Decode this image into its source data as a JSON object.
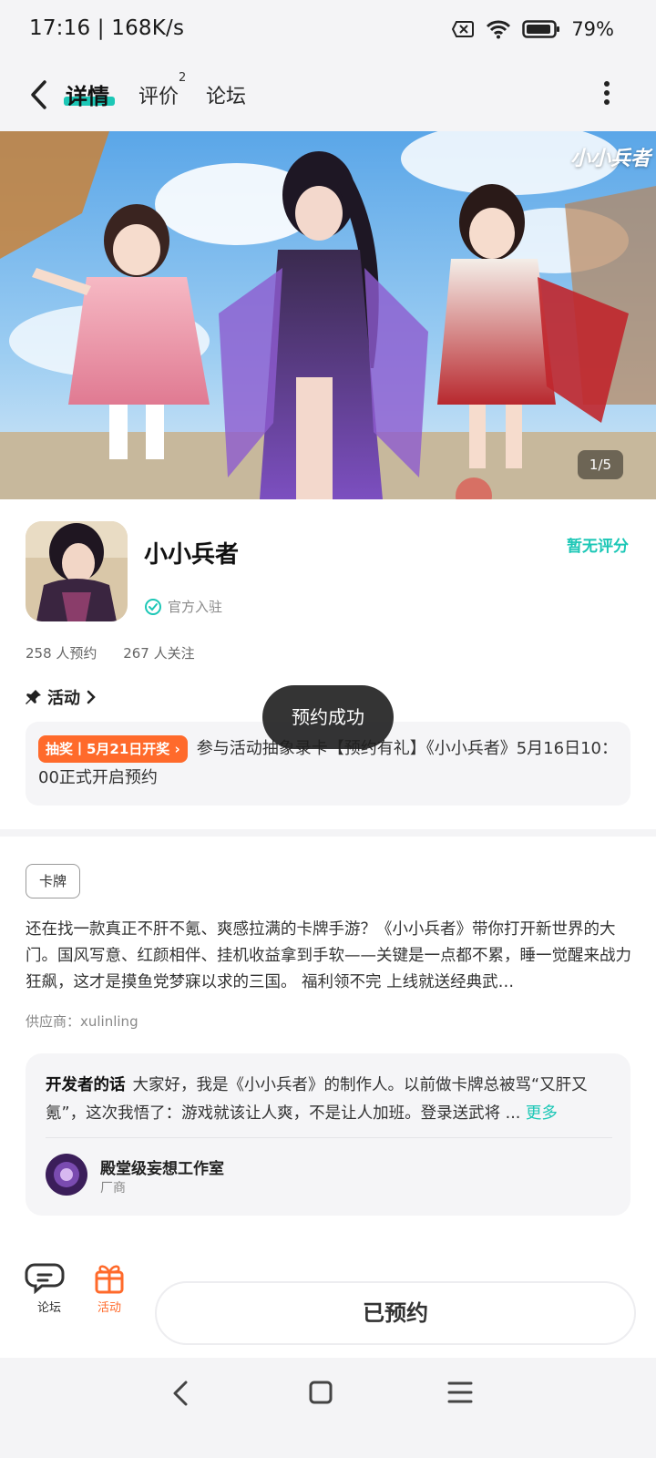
{
  "status_bar": {
    "time": "17:16 | 168K/s",
    "battery": "79%"
  },
  "header": {
    "tabs": [
      {
        "label": "详情",
        "active": true
      },
      {
        "label": "评价",
        "badge": "2"
      },
      {
        "label": "论坛"
      }
    ]
  },
  "banner": {
    "logo_text": "小小兵者",
    "page_indicator": "1/5"
  },
  "game": {
    "title": "小小兵者",
    "rating": "暂无评分",
    "official": "官方入驻",
    "reservations": "258 人预约",
    "followers": "267 人关注"
  },
  "activity": {
    "heading": "活动",
    "tag": "抽奖丨5月21日开奖",
    "text": "参与活动抽象录卡【预约有礼】《小小兵者》5月16日10：00正式开启预约"
  },
  "toast": "预约成功",
  "category_tag": "卡牌",
  "description": "还在找一款真正不肝不氪、爽感拉满的卡牌手游？《小小兵者》带你打开新世界的大门。国风写意、红颜相伴、挂机收益拿到手软——关键是一点都不累，睡一觉醒来战力狂飙，这才是摸鱼党梦寐以求的三国。 福利领不完 上线就送经典武…",
  "supplier": "供应商：xulinling",
  "developer": {
    "label": "开发者的话",
    "text": "大家好，我是《小小兵者》的制作人。以前做卡牌总被骂“又肝又氪”，这次我悟了：游戏就该让人爽，不是让人加班。登录送武将 ...",
    "more": "更多",
    "studio_name": "殿堂级妄想工作室",
    "studio_role": "厂商"
  },
  "bottom": {
    "forum_label": "论坛",
    "activity_label": "活动",
    "reserved_button": "已预约"
  },
  "colors": {
    "accent": "#1cc7b6",
    "orange": "#ff6a2b"
  }
}
